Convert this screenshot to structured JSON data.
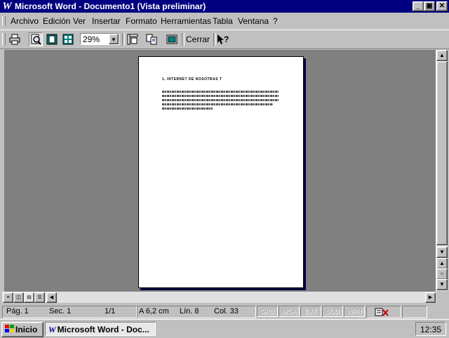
{
  "window": {
    "title": "Microsoft Word - Documento1 (Vista preliminar)",
    "app_icon": "W"
  },
  "menubar": {
    "items": [
      "Archivo",
      "Edición",
      "Ver",
      "Insertar",
      "Formato",
      "Herramientas",
      "Tabla",
      "Ventana",
      "?"
    ]
  },
  "toolbar": {
    "zoom": "29%",
    "close_label": "Cerrar",
    "buttons": [
      "print-icon",
      "magnifier-icon",
      "one-page-icon",
      "multiple-pages-icon",
      "view-ruler-icon",
      "shrink-to-fit-icon",
      "full-screen-icon",
      "context-help-icon"
    ]
  },
  "document": {
    "heading": "1.    INTERNET DE NOSOTRAS T"
  },
  "statusbar": {
    "page": "Pág. 1",
    "section": "Sec. 1",
    "page_count": "1/1",
    "position": "A  6,2 cm",
    "line": "Lín. 8",
    "column": "Col. 33",
    "modes": [
      "GRB",
      "MCA",
      "EXT",
      "SOB",
      "WPH"
    ]
  },
  "taskbar": {
    "start_label": "Inicio",
    "task_label": "Microsoft Word - Doc...",
    "clock": "12:35"
  },
  "colors": {
    "titlebar": "#000080",
    "face": "#c0c0c0",
    "preview_bg": "#808080"
  }
}
